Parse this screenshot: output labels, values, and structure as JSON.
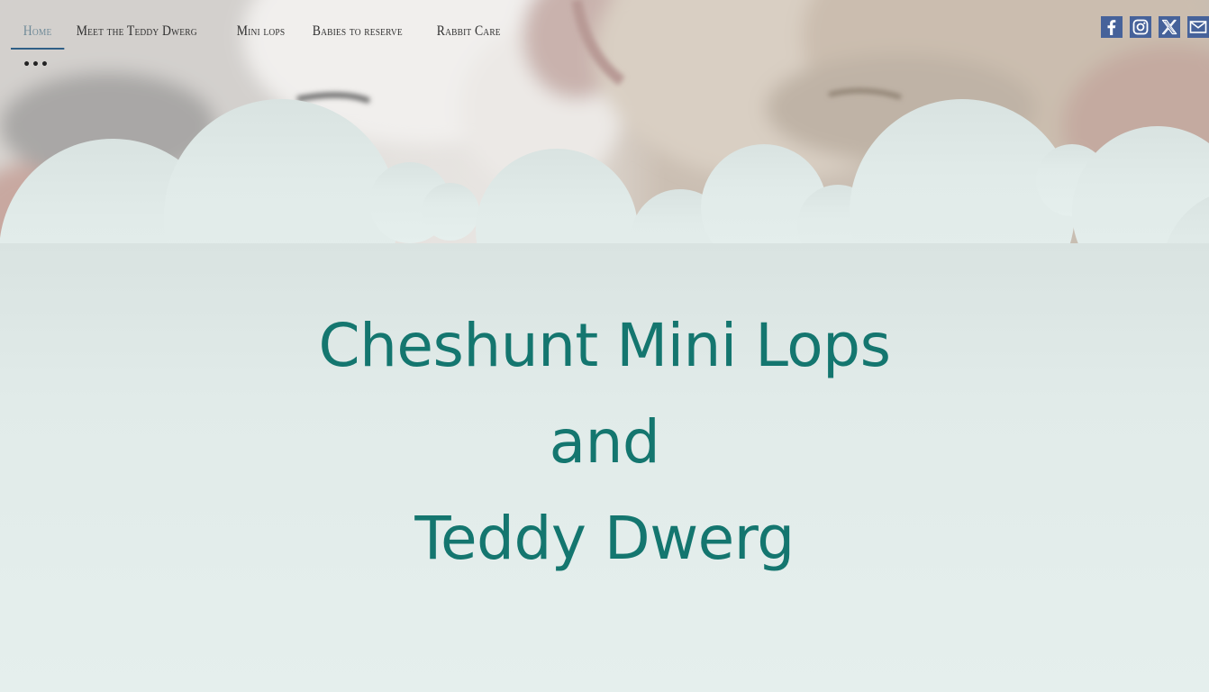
{
  "nav": {
    "items": [
      {
        "label": "Home"
      },
      {
        "label": "Meet the Teddy Dwerg"
      },
      {
        "label": "Mini lops"
      },
      {
        "label": "Babies to reserve"
      },
      {
        "label": "Rabbit Care"
      }
    ],
    "more_label": "•••"
  },
  "social": {
    "items": [
      {
        "icon": "facebook-icon"
      },
      {
        "icon": "instagram-icon"
      },
      {
        "icon": "x-icon"
      },
      {
        "icon": "email-icon"
      }
    ],
    "color": "#46629a"
  },
  "hero": {
    "title_line1": "Cheshunt Mini Lops",
    "title_line2": "and",
    "title_line3": "Teddy Dwerg",
    "title_color": "#14766f",
    "background_color": "#e4eeec"
  }
}
